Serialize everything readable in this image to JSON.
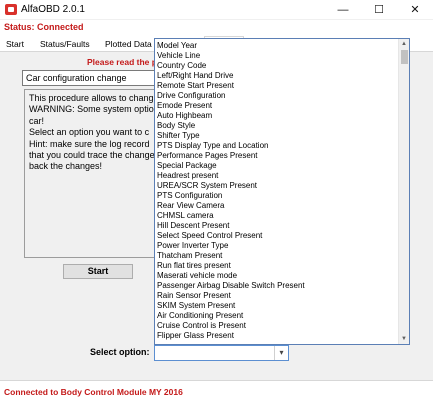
{
  "window": {
    "title": "AlfaOBD 2.0.1",
    "minimize": "—",
    "maximize": "☐",
    "close": "✕"
  },
  "status": "Status: Connected",
  "tabs": [
    {
      "label": "Start"
    },
    {
      "label": "Status/Faults"
    },
    {
      "label": "Plotted Data"
    },
    {
      "label": ""
    }
  ],
  "main": {
    "instruction": "Please read the procedure",
    "procedure_value": "Car configuration change",
    "description_lines": [
      "This procedure allows to change",
      "WARNING: Some system options",
      "car!",
      "Select an option you want to c",
      "Hint: make sure the log record",
      "that you could trace the change",
      "back the changes!"
    ],
    "start_label": "Start",
    "select_option_label": "Select option:",
    "select_option_value": ""
  },
  "dropdown": {
    "items": [
      "Model Year",
      "Vehicle Line",
      "Country Code",
      "Left/Right Hand Drive",
      "Remote Start Present",
      "Drive Configuration",
      "Emode Present",
      "Auto Highbeam",
      "Body Style",
      "Shifter Type",
      "PTS Display Type and Location",
      "Performance Pages Present",
      "Special Package",
      "Headrest present",
      "UREA/SCR System Present",
      "PTS Configuration",
      "Rear View Camera",
      "CHMSL camera",
      "Hill Descent Present",
      "Select Speed Control Present",
      "Power Inverter Type",
      "Thatcham Present",
      "Run flat tires present",
      "Maserati vehicle mode",
      "Passenger Airbag Disable Switch Present",
      "Rain Sensor Present",
      "SKIM System Present",
      "Air Conditioning Present",
      "Cruise Control is Present",
      "Flipper Glass Present"
    ]
  },
  "footer": {
    "text": "Connected to Body Control Module MY 2016"
  },
  "colors": {
    "accent_red": "#c41a1a",
    "selection_border": "#5b7fb5"
  }
}
